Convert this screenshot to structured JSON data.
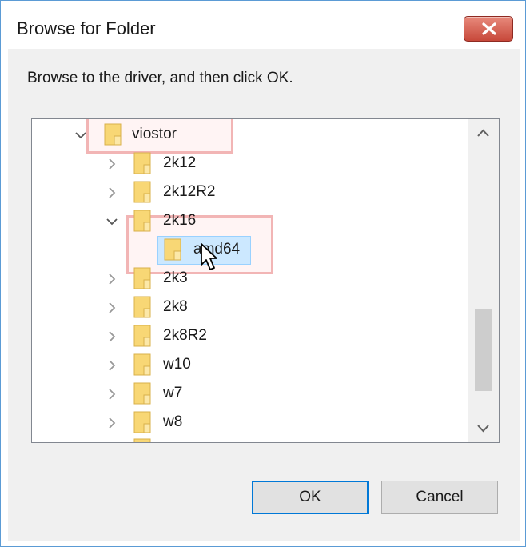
{
  "window": {
    "title": "Browse for Folder",
    "close_icon": "close-icon"
  },
  "instruction": "Browse to the driver, and then click OK.",
  "tree": {
    "nodes": [
      {
        "label": "viostor",
        "expanded": true,
        "level": 0
      },
      {
        "label": "2k12",
        "expanded": false,
        "level": 1
      },
      {
        "label": "2k12R2",
        "expanded": false,
        "level": 1
      },
      {
        "label": "2k16",
        "expanded": true,
        "level": 1
      },
      {
        "label": "amd64",
        "expanded": false,
        "level": 2,
        "selected": true
      },
      {
        "label": "2k3",
        "expanded": false,
        "level": 1
      },
      {
        "label": "2k8",
        "expanded": false,
        "level": 1
      },
      {
        "label": "2k8R2",
        "expanded": false,
        "level": 1
      },
      {
        "label": "w10",
        "expanded": false,
        "level": 1
      },
      {
        "label": "w7",
        "expanded": false,
        "level": 1
      },
      {
        "label": "w8",
        "expanded": false,
        "level": 1
      }
    ]
  },
  "buttons": {
    "ok_label": "OK",
    "cancel_label": "Cancel"
  },
  "colors": {
    "selection": "#cce8ff",
    "folder": "#f8d775",
    "close_button": "#c7483a",
    "focus_border": "#0078d7"
  }
}
